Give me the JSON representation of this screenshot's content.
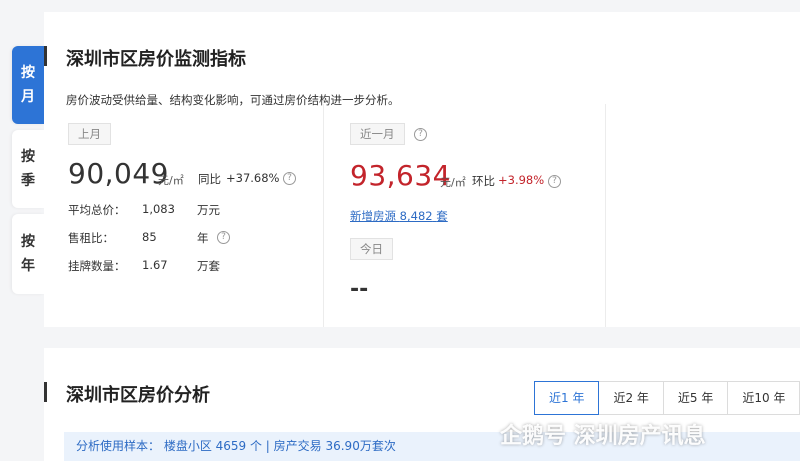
{
  "side_tabs": [
    {
      "label_1": "按",
      "label_2": "月"
    },
    {
      "label_1": "按",
      "label_2": "季"
    },
    {
      "label_1": "按",
      "label_2": "年"
    }
  ],
  "monitor": {
    "title": "深圳市区房价监测指标",
    "subtitle": "房价波动受供给量、结构变化影响，可通过房价结构进一步分析。",
    "last_month": {
      "tag": "上月",
      "price": "90,049",
      "unit": "元/㎡",
      "yoy_label": "同比",
      "yoy_value": "+37.68%",
      "rows": [
        {
          "label": "平均总价：",
          "value": "1,083",
          "unit": "万元"
        },
        {
          "label": "售租比：",
          "value": "85",
          "unit": "年"
        },
        {
          "label": "挂牌数量：",
          "value": "1.67",
          "unit": "万套"
        }
      ]
    },
    "recent_month": {
      "tag": "近一月",
      "price": "93,634",
      "unit": "元/㎡",
      "mom_label": "环比",
      "mom_value": "+3.98%",
      "new_listings_label": "新增房源",
      "new_listings_value": "8,482",
      "new_listings_unit": "套",
      "today_tag": "今日",
      "today_value": "--"
    },
    "help_icon": "?"
  },
  "analysis": {
    "title": "深圳市区房价分析",
    "period_tabs": [
      "近1 年",
      "近2 年",
      "近5 年",
      "近10 年"
    ],
    "sample_text": "分析使用样本：  楼盘小区 4659 个    |    房产交易 36.90万套次"
  },
  "watermark": "企鹅号 深圳房产讯息"
}
